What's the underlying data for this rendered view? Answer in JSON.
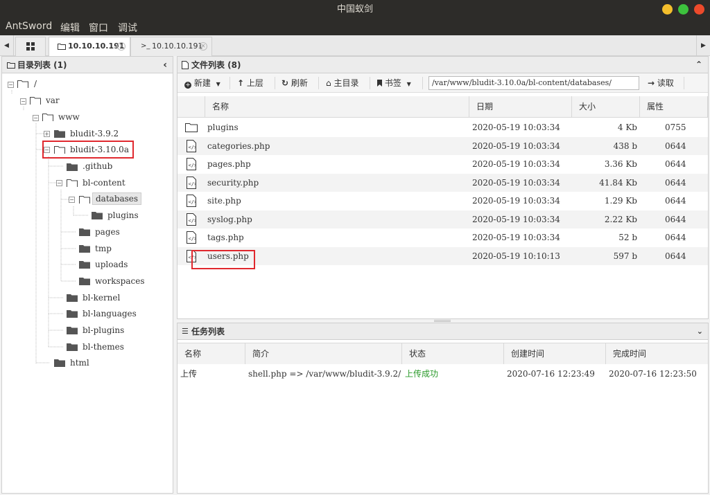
{
  "window": {
    "title": "中国蚁剑"
  },
  "menu": [
    "AntSword",
    "编辑",
    "窗口",
    "调试"
  ],
  "tabs": [
    {
      "label": "10.10.10.191",
      "icon": "folder-icon"
    },
    {
      "label": "10.10.10.191",
      "icon": "terminal-icon"
    }
  ],
  "dir_panel": {
    "title": "目录列表 (1)",
    "nodes": [
      "/",
      "var",
      "www",
      "bludit-3.9.2",
      "bludit-3.10.0a",
      ".github",
      "bl-content",
      "databases",
      "plugins",
      "pages",
      "tmp",
      "uploads",
      "workspaces",
      "bl-kernel",
      "bl-languages",
      "bl-plugins",
      "bl-themes",
      "html"
    ]
  },
  "file_panel": {
    "title": "文件列表 (8)",
    "toolbar": {
      "new": "新建",
      "up": "上层",
      "refresh": "刷新",
      "home": "主目录",
      "bookmark": "书签",
      "path": "/var/www/bludit-3.10.0a/bl-content/databases/",
      "read": "读取"
    },
    "columns": [
      "名称",
      "日期",
      "大小",
      "属性"
    ],
    "rows": [
      {
        "name": "plugins",
        "date": "2020-05-19 10:03:34",
        "size": "4 Kb",
        "perm": "0755",
        "type": "folder"
      },
      {
        "name": "categories.php",
        "date": "2020-05-19 10:03:34",
        "size": "438 b",
        "perm": "0644",
        "type": "file"
      },
      {
        "name": "pages.php",
        "date": "2020-05-19 10:03:34",
        "size": "3.36 Kb",
        "perm": "0644",
        "type": "file"
      },
      {
        "name": "security.php",
        "date": "2020-05-19 10:03:34",
        "size": "41.84 Kb",
        "perm": "0644",
        "type": "file"
      },
      {
        "name": "site.php",
        "date": "2020-05-19 10:03:34",
        "size": "1.29 Kb",
        "perm": "0644",
        "type": "file"
      },
      {
        "name": "syslog.php",
        "date": "2020-05-19 10:03:34",
        "size": "2.22 Kb",
        "perm": "0644",
        "type": "file"
      },
      {
        "name": "tags.php",
        "date": "2020-05-19 10:03:34",
        "size": "52 b",
        "perm": "0644",
        "type": "file"
      },
      {
        "name": "users.php",
        "date": "2020-05-19 10:10:13",
        "size": "597 b",
        "perm": "0644",
        "type": "file"
      }
    ]
  },
  "task_panel": {
    "title": "任务列表",
    "columns": [
      "名称",
      "简介",
      "状态",
      "创建时间",
      "完成时间"
    ],
    "rows": [
      {
        "name": "上传",
        "desc": "shell.php => /var/www/bludit-3.9.2/",
        "status": "上传成功",
        "created": "2020-07-16 12:23:49",
        "finished": "2020-07-16 12:23:50"
      }
    ]
  },
  "colors": {
    "highlight": "#e0282e",
    "success": "#2a9a2a",
    "titlebar": "#2d2c29"
  }
}
